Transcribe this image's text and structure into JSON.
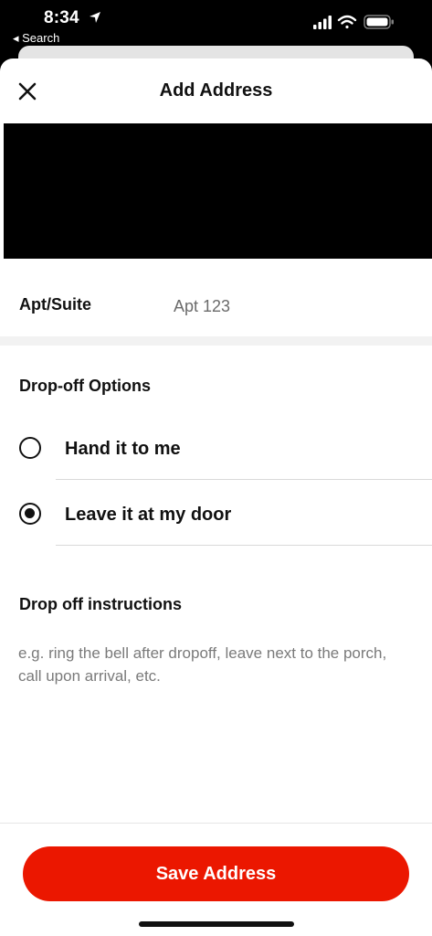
{
  "status_bar": {
    "time": "8:34",
    "back_label": "◂ Search"
  },
  "header": {
    "title": "Add Address"
  },
  "apt": {
    "label": "Apt/Suite",
    "placeholder": "Apt 123",
    "value": ""
  },
  "dropoff": {
    "title": "Drop-off Options",
    "options": [
      {
        "label": "Hand it to me",
        "selected": false
      },
      {
        "label": "Leave it at my door",
        "selected": true
      }
    ]
  },
  "instructions": {
    "title": "Drop off instructions",
    "placeholder": "e.g. ring the bell after dropoff, leave next to the porch, call upon arrival, etc."
  },
  "footer": {
    "save_label": "Save Address"
  },
  "colors": {
    "accent": "#eb1700"
  }
}
